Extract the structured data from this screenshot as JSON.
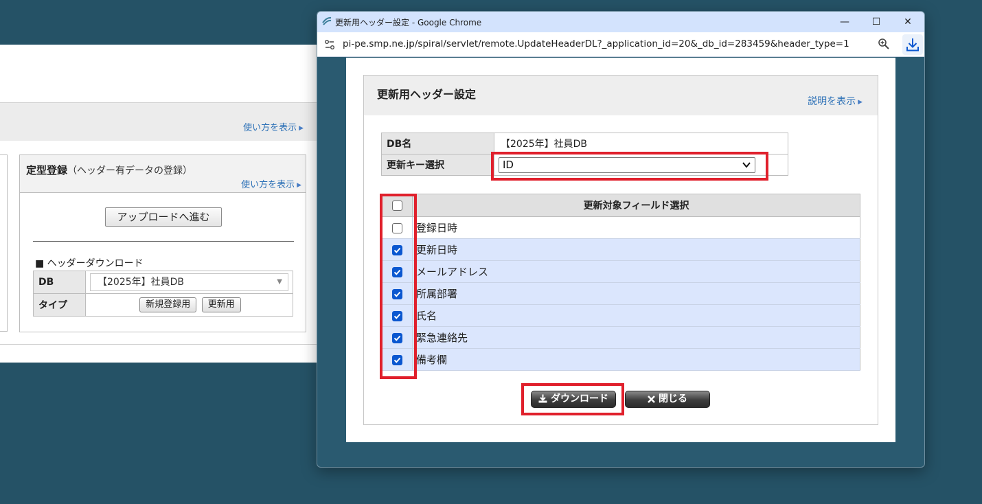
{
  "background": {
    "howto_top": "使い方を表示",
    "box": {
      "title_bold": "定型登録",
      "title_sub": "（ヘッダー有データの登録）",
      "howto": "使い方を表示",
      "upload_button": "アップロードへ進む",
      "download_title": "■ ヘッダーダウンロード",
      "db_label": "DB",
      "db_value": "【2025年】社員DB",
      "type_label": "タイプ",
      "btn_new": "新規登録用",
      "btn_update": "更新用"
    }
  },
  "window": {
    "title": "更新用ヘッダー設定 - Google Chrome",
    "url": "pi-pe.smp.ne.jp/spiral/servlet/remote.UpdateHeaderDL?_application_id=20&_db_id=283459&header_type=1"
  },
  "panel": {
    "title": "更新用ヘッダー設定",
    "help": "説明を表示",
    "db_label": "DB名",
    "db_value": "【2025年】社員DB",
    "key_label": "更新キー選択",
    "key_value": "ID",
    "fields_header": "更新対象フィールド選択",
    "fields": [
      {
        "name": "登録日時",
        "checked": false
      },
      {
        "name": "更新日時",
        "checked": true
      },
      {
        "name": "メールアドレス",
        "checked": true
      },
      {
        "name": "所属部署",
        "checked": true
      },
      {
        "name": "氏名",
        "checked": true
      },
      {
        "name": "緊急連絡先",
        "checked": true
      },
      {
        "name": "備考欄",
        "checked": true
      }
    ],
    "download_button": "ダウンロード",
    "close_button": "閉じる"
  },
  "colors": {
    "desktop": "#255266",
    "highlight": "#e0202c",
    "link": "#2a6fb6",
    "checkbox": "#0b57d0"
  },
  "icons": [
    "app-icon",
    "site-info-icon",
    "zoom-icon",
    "download-icon",
    "chevron-down-icon",
    "checkmark-icon",
    "close-x-icon"
  ]
}
